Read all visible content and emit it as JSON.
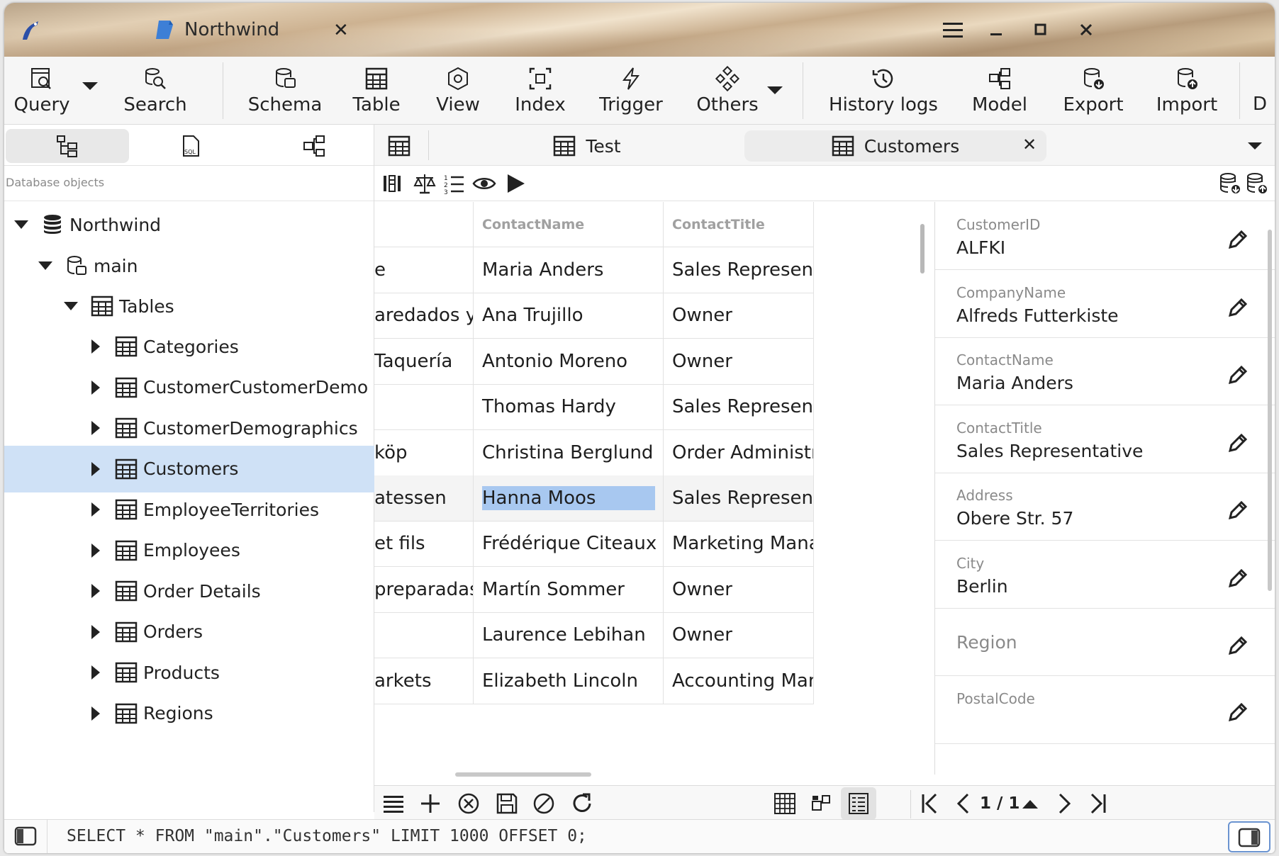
{
  "window": {
    "tab_title": "Northwind",
    "tab_close": "✕",
    "controls": [
      "menu-icon",
      "minimize-icon",
      "maximize-icon",
      "close-icon"
    ]
  },
  "toolbar": {
    "query": "Query",
    "search": "Search",
    "schema": "Schema",
    "table": "Table",
    "view": "View",
    "index": "Index",
    "trigger": "Trigger",
    "others": "Others",
    "history": "History logs",
    "model": "Model",
    "export": "Export",
    "import": "Import",
    "more": "D"
  },
  "left": {
    "section_label": "Database objects",
    "tree": {
      "db": "Northwind",
      "schema": "main",
      "tables_folder": "Tables",
      "tables": [
        "Categories",
        "CustomerCustomerDemo",
        "CustomerDemographics",
        "Customers",
        "EmployeeTerritories",
        "Employees",
        "Order Details",
        "Orders",
        "Products",
        "Regions"
      ],
      "selected": "Customers"
    }
  },
  "tabs": {
    "items": [
      "Test",
      "Customers"
    ],
    "active": "Customers",
    "close": "✕"
  },
  "grid": {
    "columns": [
      "",
      "ContactName",
      "ContactTitle"
    ],
    "rows": [
      [
        "e",
        "Maria Anders",
        "Sales Representativ"
      ],
      [
        "aredados y helados",
        "Ana Trujillo",
        "Owner"
      ],
      [
        "Taquería",
        "Antonio Moreno",
        "Owner"
      ],
      [
        "",
        "Thomas Hardy",
        "Sales Representativ"
      ],
      [
        "köp",
        "Christina Berglund",
        "Order Administrator"
      ],
      [
        "atessen",
        "Hanna Moos",
        "Sales Representativ"
      ],
      [
        " et fils",
        "Frédérique Citeaux",
        "Marketing Manager"
      ],
      [
        "preparadas",
        "Martín Sommer",
        "Owner"
      ],
      [
        "",
        "Laurence Lebihan",
        "Owner"
      ],
      [
        "arkets",
        "Elizabeth Lincoln",
        "Accounting Manage"
      ]
    ],
    "selected_cell": "Hanna Moos"
  },
  "detail": {
    "fields": [
      {
        "label": "CustomerID",
        "value": "ALFKI"
      },
      {
        "label": "CompanyName",
        "value": "Alfreds Futterkiste"
      },
      {
        "label": "ContactName",
        "value": "Maria Anders"
      },
      {
        "label": "ContactTitle",
        "value": "Sales Representative"
      },
      {
        "label": "Address",
        "value": "Obere Str. 57"
      },
      {
        "label": "City",
        "value": "Berlin"
      },
      {
        "label": "Region",
        "value": ""
      },
      {
        "label": "PostalCode",
        "value": ""
      }
    ],
    "region_placeholder": "Region"
  },
  "pager": {
    "text": "1 / 1"
  },
  "status": {
    "sql": "SELECT * FROM \"main\".\"Customers\" LIMIT 1000 OFFSET 0;"
  }
}
